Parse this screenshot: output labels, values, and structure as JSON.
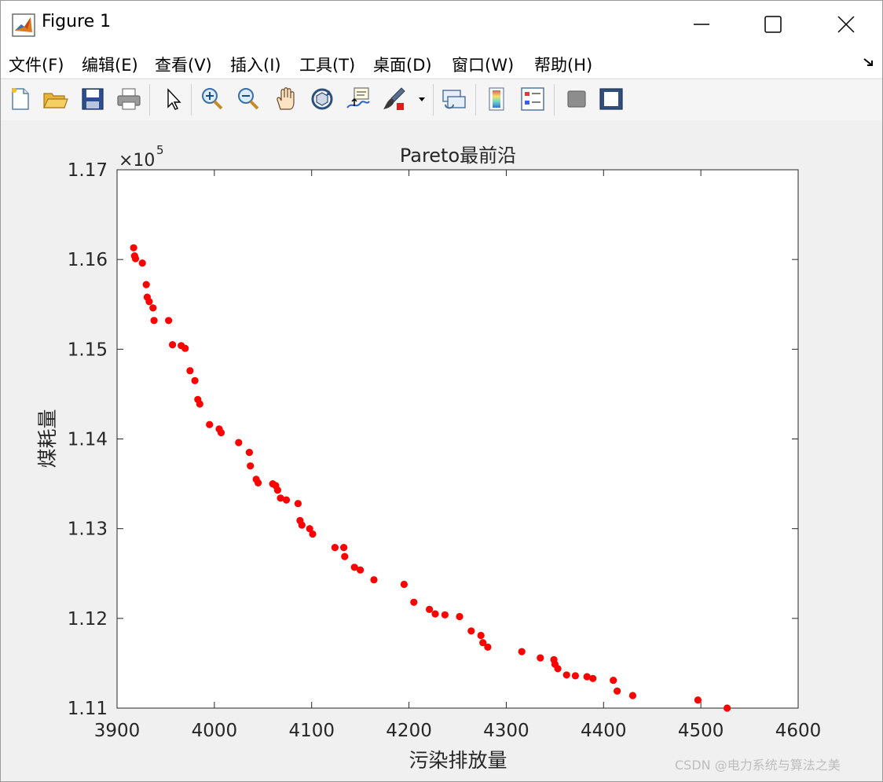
{
  "window": {
    "title": "Figure 1",
    "controls": {
      "minimize": "minimize",
      "maximize": "maximize",
      "close": "close"
    }
  },
  "menubar": {
    "items": [
      {
        "label": "文件(F)"
      },
      {
        "label": "编辑(E)"
      },
      {
        "label": "查看(V)"
      },
      {
        "label": "插入(I)"
      },
      {
        "label": "工具(T)"
      },
      {
        "label": "桌面(D)"
      },
      {
        "label": "窗口(W)"
      },
      {
        "label": "帮助(H)"
      }
    ]
  },
  "toolbar": {
    "buttons": [
      "new-figure-icon",
      "open-file-icon",
      "save-icon",
      "print-icon",
      "pointer-icon",
      "zoom-in-icon",
      "zoom-out-icon",
      "pan-hand-icon",
      "rotate-3d-icon",
      "data-cursor-icon",
      "brush-icon",
      "link-plot-icon",
      "colorbar-icon",
      "legend-icon",
      "hide-plot-tools-icon",
      "show-plot-tools-icon"
    ]
  },
  "chart_data": {
    "type": "scatter",
    "title": "Pareto最前沿",
    "xlabel": "污染排放量",
    "ylabel": "煤耗量",
    "y_exponent_label": "×10",
    "y_exponent_power": "5",
    "xlim": [
      3900,
      4600
    ],
    "ylim": [
      111000,
      117000
    ],
    "x_ticks": [
      "3900",
      "4000",
      "4100",
      "4200",
      "4300",
      "4400",
      "4500",
      "4600"
    ],
    "y_ticks": [
      "1.11",
      "1.12",
      "1.13",
      "1.14",
      "1.15",
      "1.16",
      "1.17"
    ],
    "marker_color": "#ff0000",
    "grid": false,
    "points": [
      [
        3917,
        116130
      ],
      [
        3918,
        116040
      ],
      [
        3919,
        116010
      ],
      [
        3926,
        115960
      ],
      [
        3930,
        115720
      ],
      [
        3931,
        115580
      ],
      [
        3933,
        115530
      ],
      [
        3937,
        115460
      ],
      [
        3938,
        115320
      ],
      [
        3953,
        115320
      ],
      [
        3957,
        115050
      ],
      [
        3966,
        115040
      ],
      [
        3970,
        115010
      ],
      [
        3975,
        114760
      ],
      [
        3980,
        114650
      ],
      [
        3983,
        114440
      ],
      [
        3985,
        114390
      ],
      [
        3995,
        114160
      ],
      [
        4005,
        114110
      ],
      [
        4007,
        114070
      ],
      [
        4025,
        113960
      ],
      [
        4036,
        113850
      ],
      [
        4037,
        113700
      ],
      [
        4043,
        113550
      ],
      [
        4045,
        113510
      ],
      [
        4060,
        113500
      ],
      [
        4063,
        113480
      ],
      [
        4065,
        113430
      ],
      [
        4068,
        113340
      ],
      [
        4074,
        113320
      ],
      [
        4086,
        113280
      ],
      [
        4088,
        113090
      ],
      [
        4090,
        113040
      ],
      [
        4098,
        113000
      ],
      [
        4101,
        112940
      ],
      [
        4124,
        112790
      ],
      [
        4133,
        112790
      ],
      [
        4134,
        112690
      ],
      [
        4144,
        112570
      ],
      [
        4150,
        112540
      ],
      [
        4164,
        112430
      ],
      [
        4195,
        112380
      ],
      [
        4205,
        112180
      ],
      [
        4221,
        112100
      ],
      [
        4227,
        112050
      ],
      [
        4237,
        112040
      ],
      [
        4252,
        112020
      ],
      [
        4264,
        111860
      ],
      [
        4274,
        111810
      ],
      [
        4276,
        111730
      ],
      [
        4281,
        111680
      ],
      [
        4316,
        111630
      ],
      [
        4335,
        111560
      ],
      [
        4349,
        111540
      ],
      [
        4350,
        111490
      ],
      [
        4353,
        111440
      ],
      [
        4362,
        111370
      ],
      [
        4371,
        111360
      ],
      [
        4383,
        111350
      ],
      [
        4389,
        111330
      ],
      [
        4410,
        111310
      ],
      [
        4414,
        111190
      ],
      [
        4430,
        111140
      ],
      [
        4497,
        111090
      ],
      [
        4527,
        111000
      ]
    ]
  },
  "watermark": {
    "text": "CSDN @电力系统与算法之美"
  }
}
